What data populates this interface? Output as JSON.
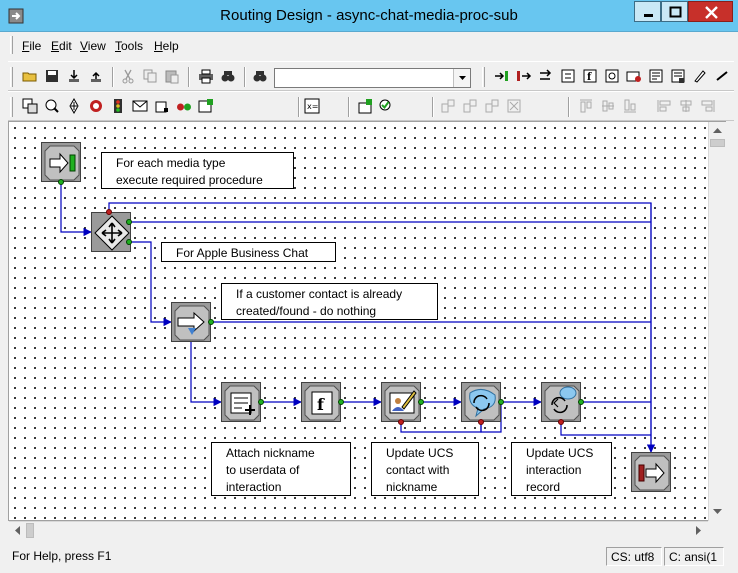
{
  "window": {
    "title": "Routing Design - async-chat-media-proc-sub"
  },
  "menu": [
    {
      "label": "File",
      "key": "F",
      "rest": "ile"
    },
    {
      "label": "Edit",
      "key": "E",
      "rest": "dit"
    },
    {
      "label": "View",
      "key": "V",
      "rest": "iew"
    },
    {
      "label": "Tools",
      "key": "T",
      "rest": "ools"
    },
    {
      "label": "Help",
      "key": "H",
      "rest": "elp"
    }
  ],
  "toolbar": {
    "search_value": ""
  },
  "notes": {
    "for_each": "For each media type\nexecute required procedure",
    "apple": "For Apple Business Chat",
    "customer": "If a customer contact is already\ncreated/found - do nothing",
    "attach": "Attach nickname\nto userdata of\ninteraction",
    "update_contact": "Update UCS\ncontact with\nnickname",
    "update_interaction": "Update UCS\ninteraction\nrecord"
  },
  "status": {
    "help": "For Help, press F1",
    "cs": "CS: utf8",
    "c": "C: ansi(1"
  },
  "colors": {
    "titlebar": "#68c6f0",
    "wire": "#0000c0",
    "node": "#9a9a9a"
  }
}
